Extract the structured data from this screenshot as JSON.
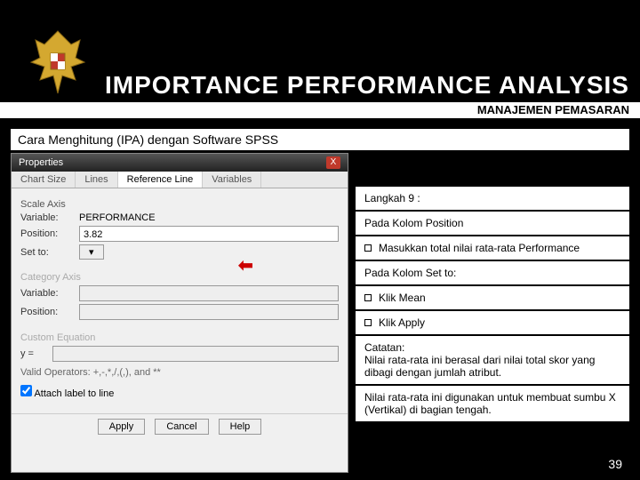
{
  "header": {
    "title": "IMPORTANCE PERFORMANCE ANALYSIS",
    "subtitle": "MANAJEMEN PEMASARAN"
  },
  "section_title": "Cara Menghitung (IPA) dengan Software SPSS",
  "spss": {
    "window_title": "Properties",
    "tabs": [
      "Chart Size",
      "Lines",
      "Reference Line",
      "Variables"
    ],
    "active_tab": 2,
    "scale_axis_label": "Scale Axis",
    "variable_label": "Variable:",
    "variable_value": "PERFORMANCE",
    "position_label": "Position:",
    "position_value": "3.82",
    "setto_label": "Set to:",
    "category_axis_label": "Category Axis",
    "cat_variable_label": "Variable:",
    "cat_position_label": "Position:",
    "custom_eq_label": "Custom Equation",
    "y_equals": "y =",
    "valid_ops": "Valid Operators: +,-,*,/,(,), and **",
    "attach_label": "Attach label to line",
    "btn_apply": "Apply",
    "btn_cancel": "Cancel",
    "btn_help": "Help"
  },
  "instructions": {
    "step": "Langkah 9 :",
    "pos_heading": "Pada Kolom Position",
    "pos_item": "Masukkan total nilai rata-rata  Performance",
    "setto_heading": "Pada Kolom Set to:",
    "setto_item1": "Klik Mean",
    "setto_item2": "Klik Apply",
    "note_label": "Catatan:",
    "note1": "Nilai rata-rata ini berasal dari nilai total skor yang dibagi dengan jumlah atribut.",
    "note2": "Nilai rata-rata ini digunakan untuk membuat sumbu X (Vertikal) di bagian tengah."
  },
  "page_number": "39"
}
